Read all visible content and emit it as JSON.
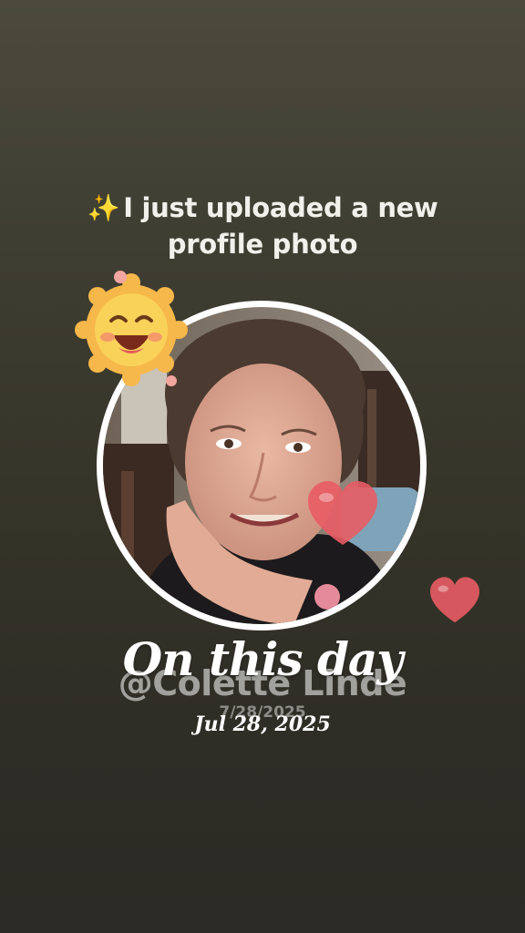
{
  "caption": {
    "sparkle_icon": "sparkles-icon",
    "sparkle_glyph": "✨",
    "line1": "I just uploaded a new",
    "line2": "profile photo"
  },
  "profile_photo": {
    "icon": "profile-photo"
  },
  "stickers": {
    "sun": "laughing-sun-icon",
    "hearts": [
      "heart-icon",
      "heart-icon"
    ]
  },
  "handle": "@Colette Linde",
  "handle_date": "7/28/2025",
  "title": "On this day",
  "date": "Jul 28, 2025",
  "colors": {
    "background_top": "#4b4a3c",
    "background_bottom": "#2b2a24",
    "ring": "#ffffff",
    "heart": "#e85c64",
    "sun": "#f6b84a"
  }
}
